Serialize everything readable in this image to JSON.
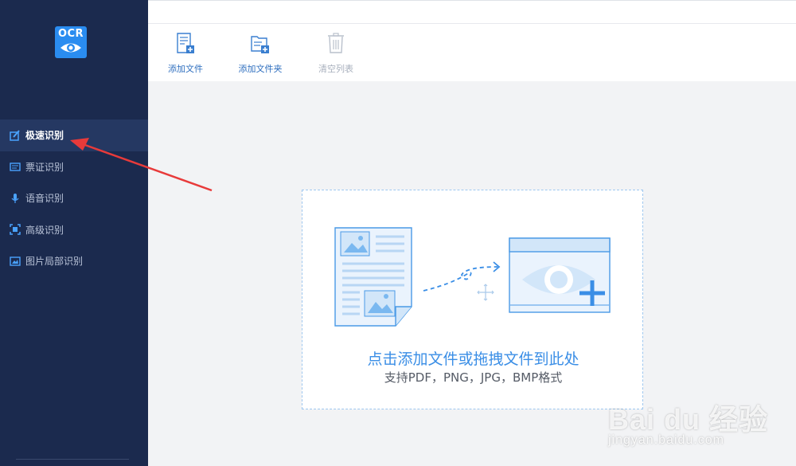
{
  "logo": {
    "text": "OCR"
  },
  "sidebar": {
    "items": [
      {
        "label": "极速识别",
        "icon": "flash-edit-icon",
        "active": true
      },
      {
        "label": "票证识别",
        "icon": "ticket-icon",
        "active": false
      },
      {
        "label": "语音识别",
        "icon": "microphone-icon",
        "active": false
      },
      {
        "label": "高级识别",
        "icon": "scan-frame-icon",
        "active": false
      },
      {
        "label": "图片局部识别",
        "icon": "image-crop-icon",
        "active": false
      }
    ]
  },
  "toolbar": {
    "add_file": "添加文件",
    "add_folder": "添加文件夹",
    "clear_list": "清空列表"
  },
  "dropzone": {
    "title": "点击添加文件或拖拽文件到此处",
    "subtitle": "支持PDF，PNG，JPG，BMP格式"
  },
  "watermark": {
    "main": "Bai du 经验",
    "sub": "jingyan.baidu.com"
  },
  "colors": {
    "sidebar_bg": "#1b2a4e",
    "sidebar_active": "#253862",
    "accent": "#2a8cf0",
    "annotation": "#e83a3a"
  }
}
